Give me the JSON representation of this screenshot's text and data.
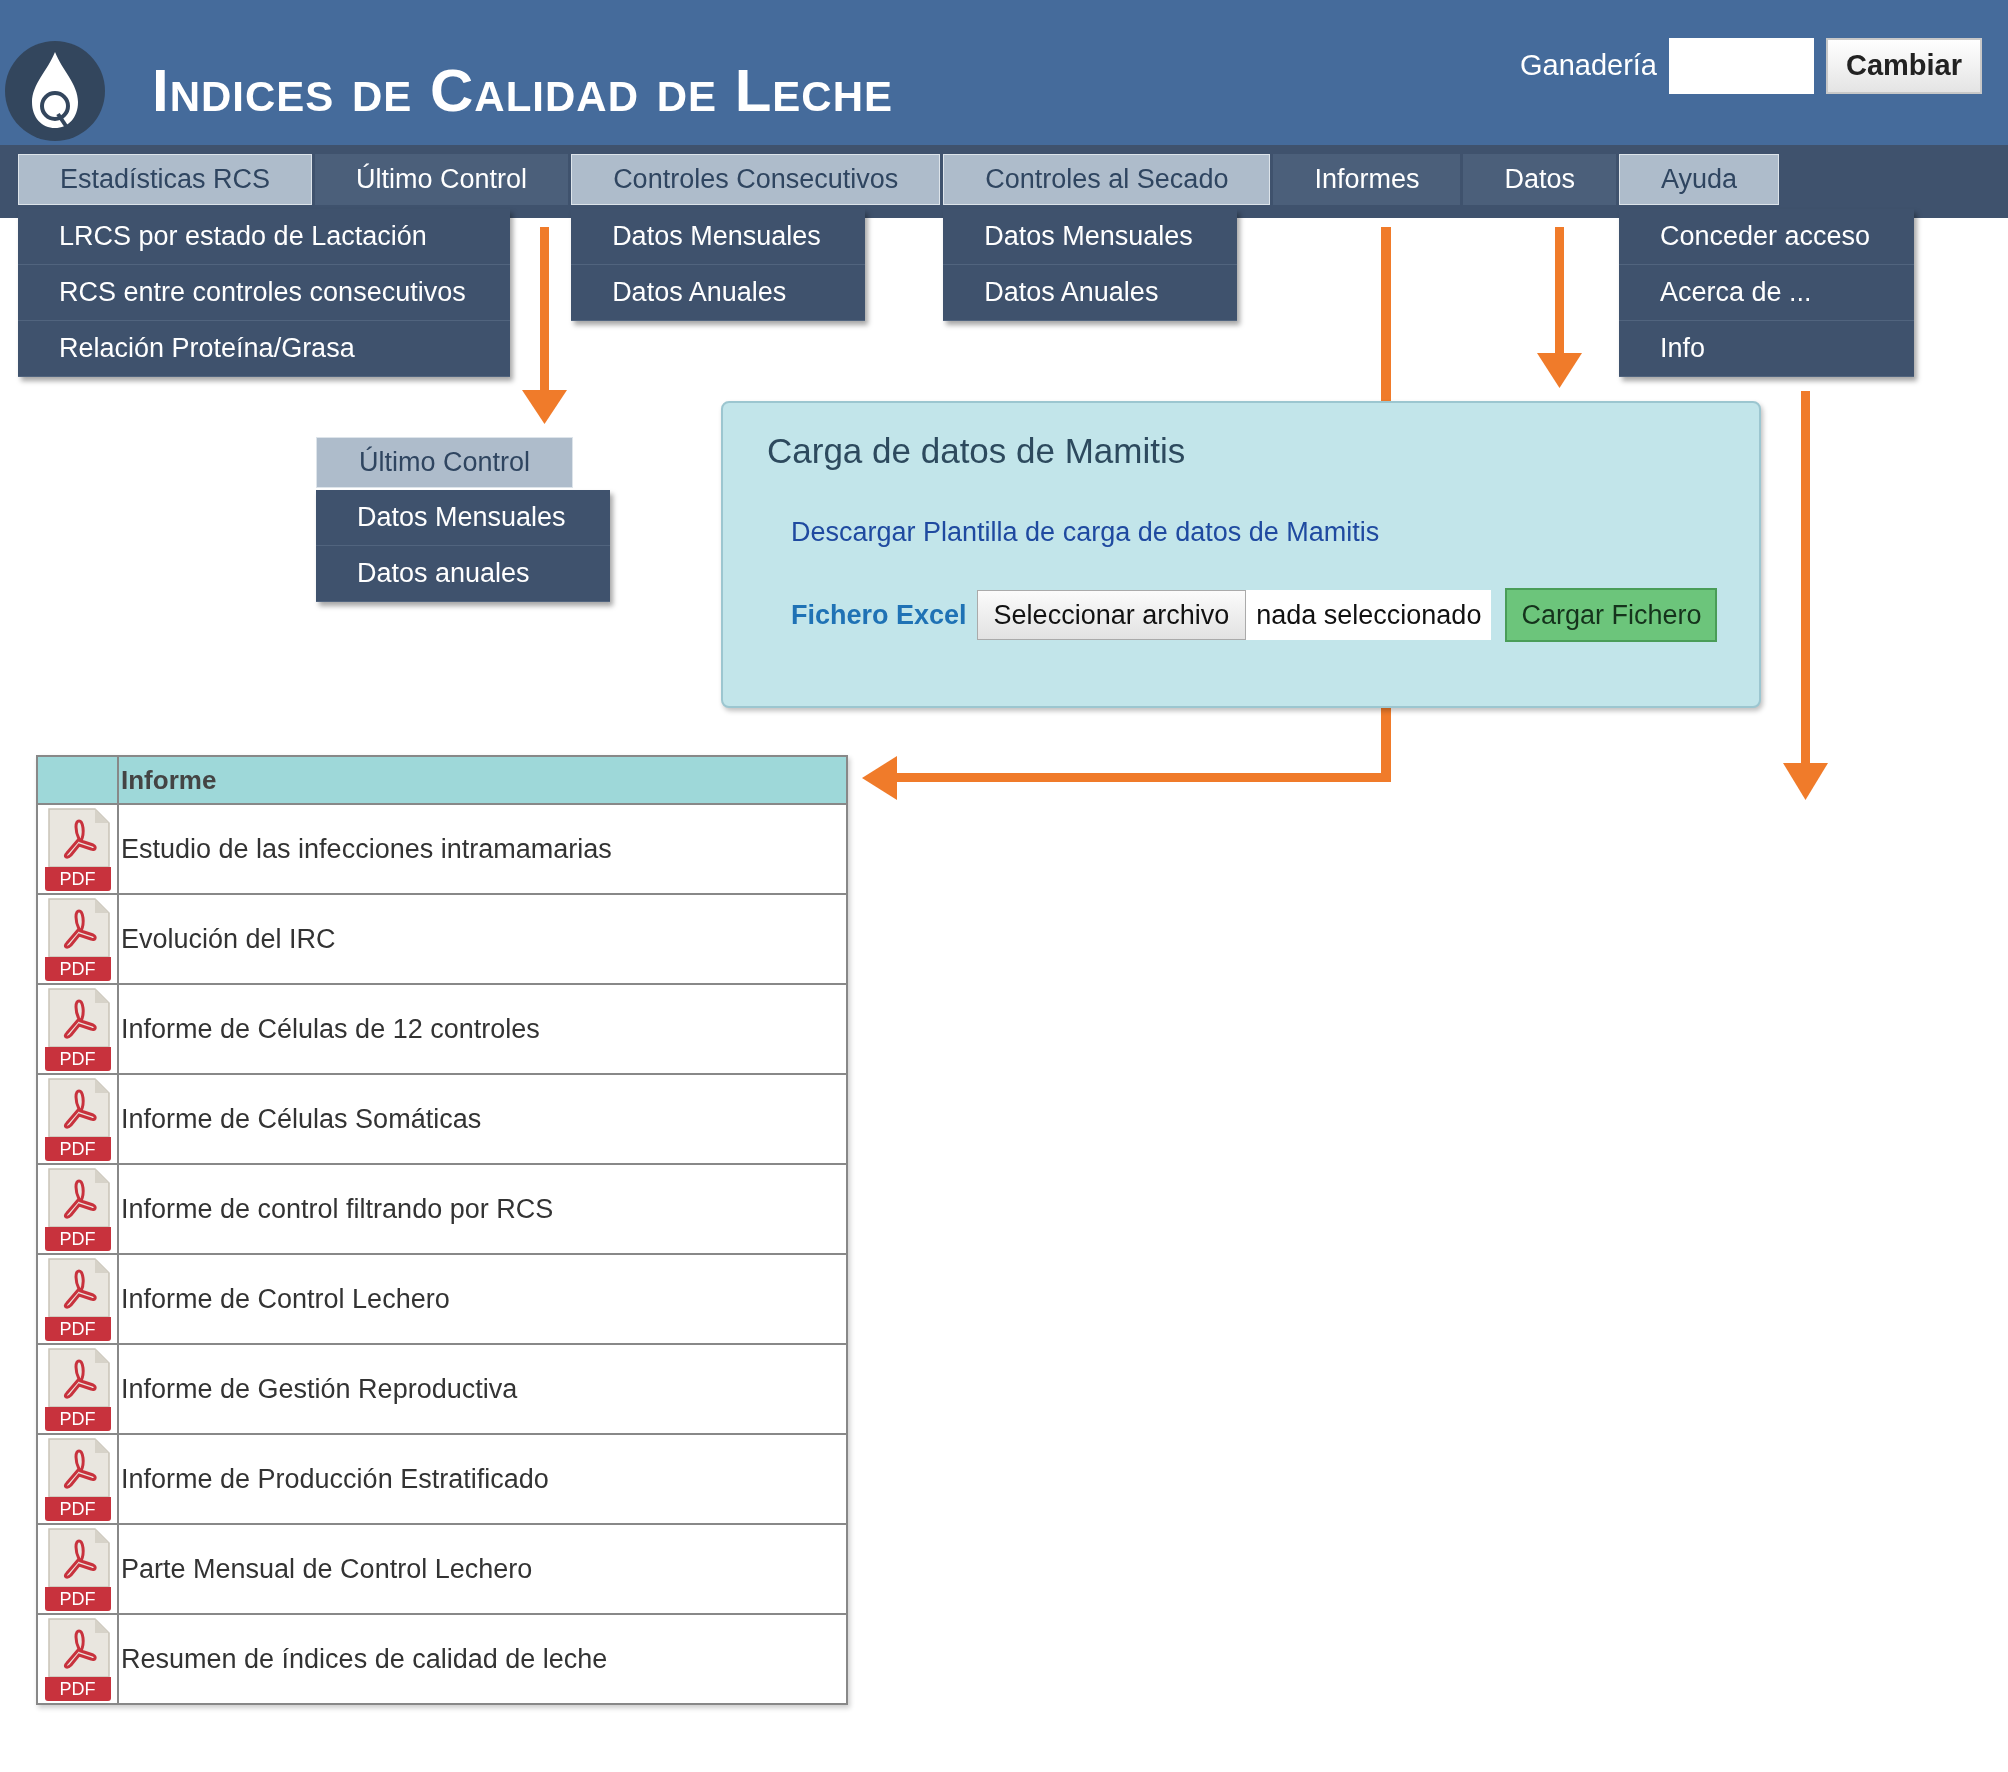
{
  "header": {
    "title": "Indices de Calidad de Leche",
    "farm_label": "Ganadería",
    "change_button": "Cambiar"
  },
  "nav": {
    "tabs": [
      {
        "label": "Estadísticas RCS",
        "expanded": true,
        "menu": [
          "LRCS por estado de Lactación",
          "RCS entre controles consecutivos",
          "Relación Proteína/Grasa"
        ]
      },
      {
        "label": "Último Control",
        "expanded": false
      },
      {
        "label": "Controles Consecutivos",
        "expanded": true,
        "menu": [
          "Datos Mensuales",
          "Datos Anuales"
        ]
      },
      {
        "label": "Controles al Secado",
        "expanded": true,
        "menu": [
          "Datos Mensuales",
          "Datos Anuales"
        ]
      },
      {
        "label": "Informes",
        "expanded": false
      },
      {
        "label": "Datos",
        "expanded": false
      },
      {
        "label": "Ayuda",
        "expanded": true,
        "menu": [
          "Conceder acceso",
          "Acerca de ...",
          "Info"
        ]
      }
    ]
  },
  "submenu_popup": {
    "tab": {
      "label": "Último Control",
      "expanded": true
    },
    "menu": [
      "Datos Mensuales",
      "Datos anuales"
    ]
  },
  "upload_card": {
    "title": "Carga de datos de Mamitis",
    "template_link": "Descargar Plantilla de carga de datos de Mamitis",
    "file_label": "Fichero Excel",
    "file_button": "Seleccionar archivo",
    "file_status": "nada seleccionado",
    "upload_button": "Cargar Fichero"
  },
  "reports_table": {
    "columns": [
      "Informe"
    ],
    "rows": [
      {
        "icon_label": "PDF",
        "name": "Estudio de las infecciones intramamarias"
      },
      {
        "icon_label": "PDF",
        "name": "Evolución del IRC"
      },
      {
        "icon_label": "PDF",
        "name": "Informe de Células de 12 controles"
      },
      {
        "icon_label": "PDF",
        "name": "Informe de Células Somáticas"
      },
      {
        "icon_label": "PDF",
        "name": "Informe de control filtrando por RCS"
      },
      {
        "icon_label": "PDF",
        "name": "Informe de Control Lechero"
      },
      {
        "icon_label": "PDF",
        "name": "Informe de Gestión Reproductiva"
      },
      {
        "icon_label": "PDF",
        "name": "Informe de Producción Estratificado"
      },
      {
        "icon_label": "PDF",
        "name": "Parte Mensual de Control Lechero"
      },
      {
        "icon_label": "PDF",
        "name": "Resumen de índices de calidad de leche"
      }
    ]
  }
}
